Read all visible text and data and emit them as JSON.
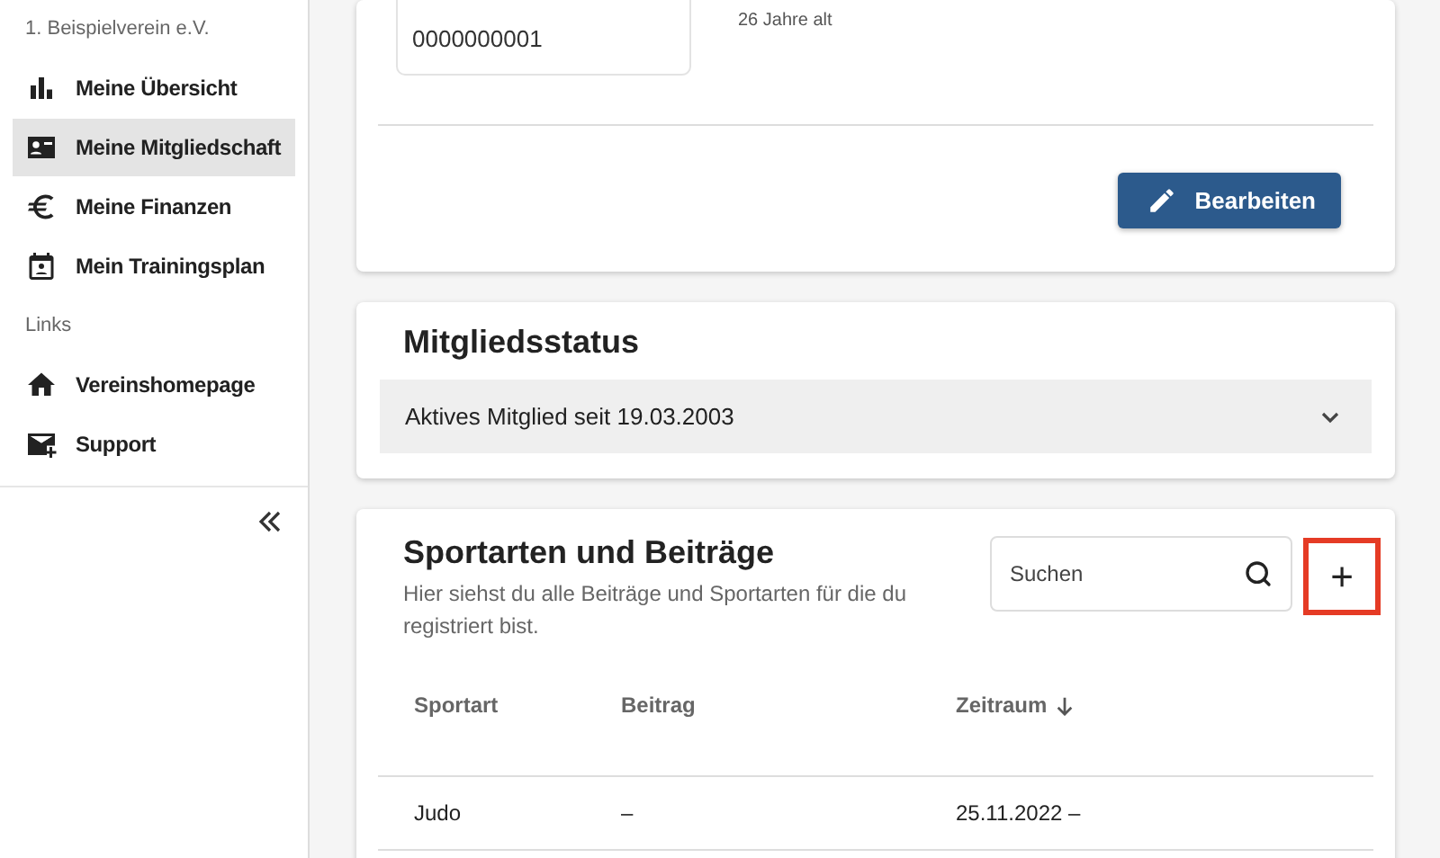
{
  "sidebar": {
    "club": "1. Beispielverein e.V.",
    "items": [
      {
        "label": "Meine Übersicht",
        "selected": false
      },
      {
        "label": "Meine Mitgliedschaft",
        "selected": true
      },
      {
        "label": "Meine Finanzen",
        "selected": false
      },
      {
        "label": "Mein Trainingsplan",
        "selected": false
      }
    ],
    "section": "Links",
    "links": [
      {
        "label": "Vereinshomepage"
      },
      {
        "label": "Support"
      }
    ]
  },
  "member_card": {
    "number": "0000000001",
    "age": "26 Jahre alt",
    "edit_button": "Bearbeiten"
  },
  "status_card": {
    "title": "Mitgliedsstatus",
    "status": "Aktives Mitglied seit 19.03.2003",
    "expanded": false
  },
  "sports_card": {
    "title": "Sportarten und Beiträge",
    "description": "Hier siehst du alle Beiträge und Sportarten für die du registriert bist.",
    "search": {
      "placeholder": "Suchen"
    },
    "add_button": {
      "label": "+",
      "highlighted": true
    },
    "table": {
      "columns": [
        {
          "label": "Sportart",
          "sorted": false
        },
        {
          "label": "Beitrag",
          "sorted": false
        },
        {
          "label": "Zeitraum",
          "sorted": true
        }
      ],
      "rows": [
        [
          "Judo",
          "–",
          "25.11.2022 –"
        ]
      ]
    }
  }
}
